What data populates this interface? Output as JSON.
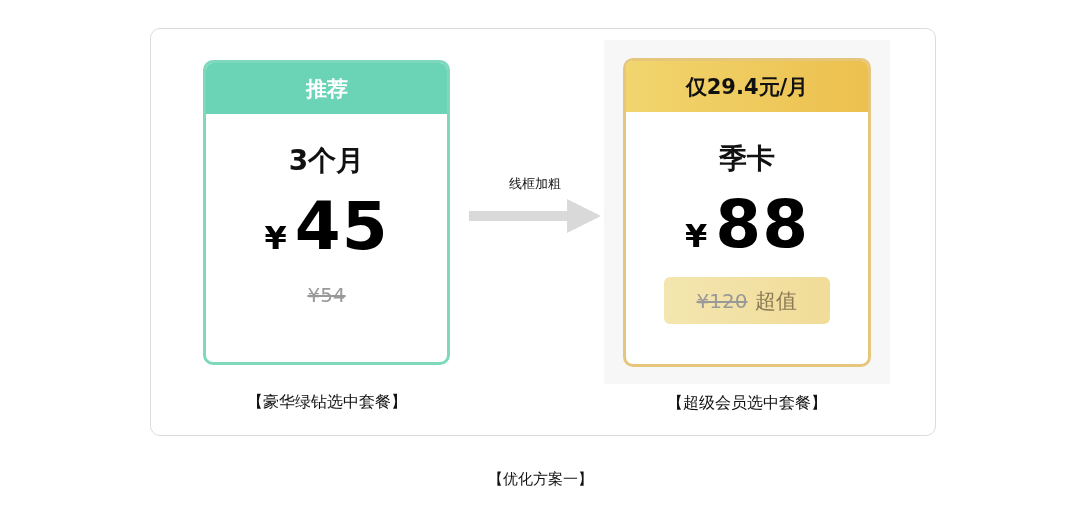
{
  "cards": [
    {
      "kind": "green",
      "header": "推荐",
      "name": "3个月",
      "currency": "¥",
      "price": "45",
      "old_price": "¥54",
      "caption": "【豪华绿钻选中套餐】"
    },
    {
      "kind": "gold",
      "header": "仅**29.4**元/月",
      "name": "季卡",
      "currency": "¥",
      "price": "88",
      "old_price": "¥120",
      "tag": "超值",
      "caption": "【超级会员选中套餐】"
    }
  ],
  "arrow": {
    "label": "线框加粗"
  },
  "footer": "【优化方案一】"
}
